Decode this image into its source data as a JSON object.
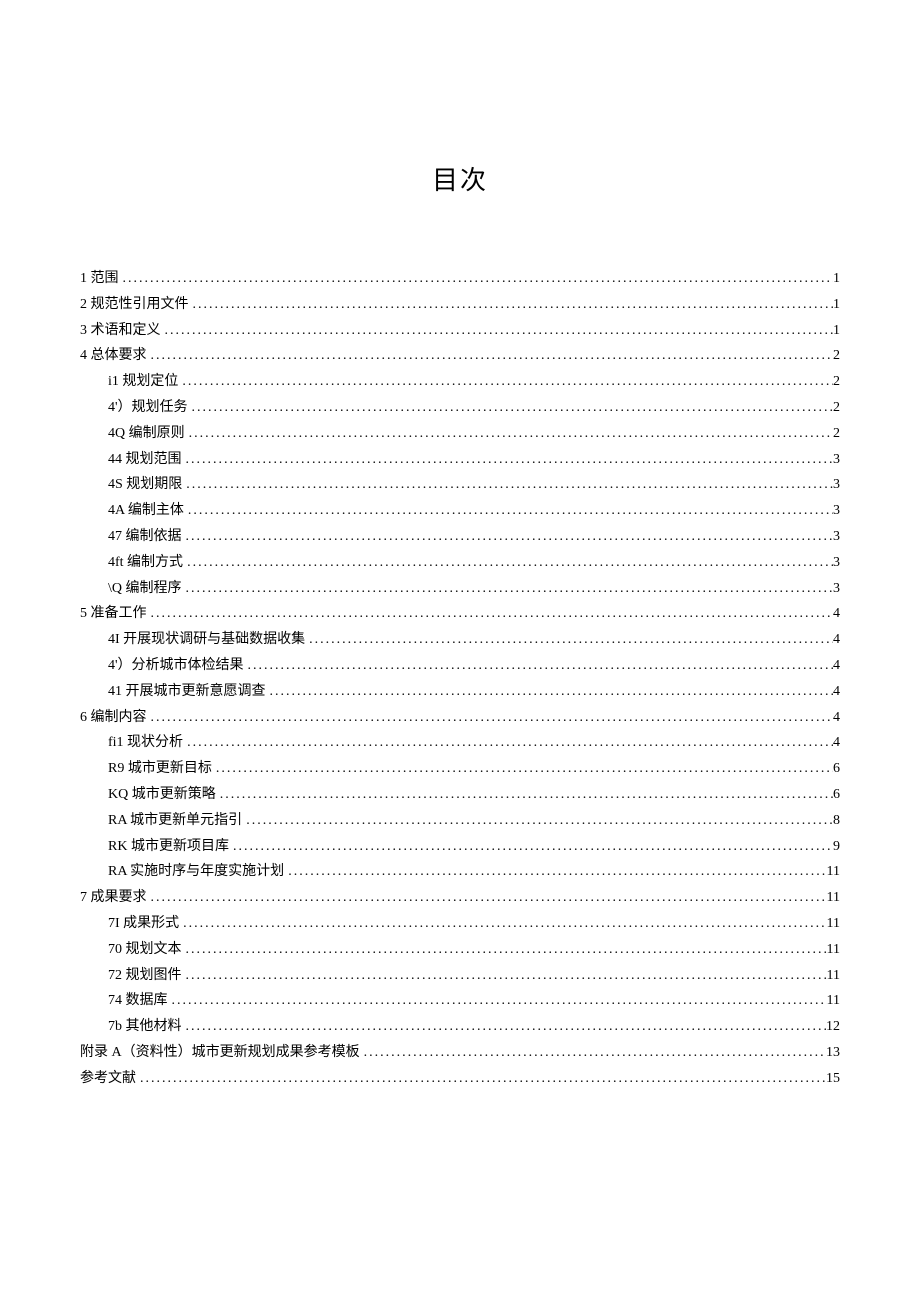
{
  "title": "目次",
  "entries": [
    {
      "level": 1,
      "label": "1 范围",
      "page": "1"
    },
    {
      "level": 1,
      "label": "2 规范性引用文件",
      "page": "1"
    },
    {
      "level": 1,
      "label": "3 术语和定义",
      "page": "1"
    },
    {
      "level": 1,
      "label": "4 总体要求",
      "page": "2"
    },
    {
      "level": 2,
      "label": "i1 规划定位",
      "page": "2"
    },
    {
      "level": 2,
      "label": "4'）规划任务",
      "page": "2"
    },
    {
      "level": 2,
      "label": "4Q 编制原则",
      "page": "2"
    },
    {
      "level": 2,
      "label": "44 规划范围",
      "page": "3"
    },
    {
      "level": 2,
      "label": "4S 规划期限",
      "page": "3"
    },
    {
      "level": 2,
      "label": "4A 编制主体",
      "page": "3"
    },
    {
      "level": 2,
      "label": "47 编制依据",
      "page": "3"
    },
    {
      "level": 2,
      "label": "4ft 编制方式",
      "page": "3"
    },
    {
      "level": 2,
      "label": "\\Q 编制程序",
      "page": "3"
    },
    {
      "level": 1,
      "label": "5 准备工作",
      "page": "4"
    },
    {
      "level": 2,
      "label": "4I 开展现状调研与基础数据收集",
      "page": "4"
    },
    {
      "level": 2,
      "label": "4'）分析城市体检结果",
      "page": "4"
    },
    {
      "level": 2,
      "label": "41 开展城市更新意愿调查",
      "page": "4"
    },
    {
      "level": 1,
      "label": "6 编制内容",
      "page": "4"
    },
    {
      "level": 2,
      "label": "fi1 现状分析",
      "page": "4"
    },
    {
      "level": 2,
      "label": "R9 城市更新目标",
      "page": "6"
    },
    {
      "level": 2,
      "label": "KQ 城市更新策略",
      "page": "6"
    },
    {
      "level": 2,
      "label": "RA 城市更新单元指引",
      "page": "8"
    },
    {
      "level": 2,
      "label": "RK 城市更新项目库",
      "page": "9"
    },
    {
      "level": 2,
      "label": "RA 实施时序与年度实施计划",
      "page": "11"
    },
    {
      "level": 1,
      "label": "7 成果要求",
      "page": "11"
    },
    {
      "level": 2,
      "label": "7I 成果形式",
      "page": "11"
    },
    {
      "level": 2,
      "label": "70 规划文本",
      "page": "11"
    },
    {
      "level": 2,
      "label": "72 规划图件",
      "page": "11"
    },
    {
      "level": 2,
      "label": "74 数据库",
      "page": "11"
    },
    {
      "level": 2,
      "label": "7b 其他材料",
      "page": "12"
    },
    {
      "level": 1,
      "label": "附录 A（资料性）城市更新规划成果参考模板",
      "page": "13"
    },
    {
      "level": 1,
      "label": "参考文献",
      "page": "15"
    }
  ]
}
